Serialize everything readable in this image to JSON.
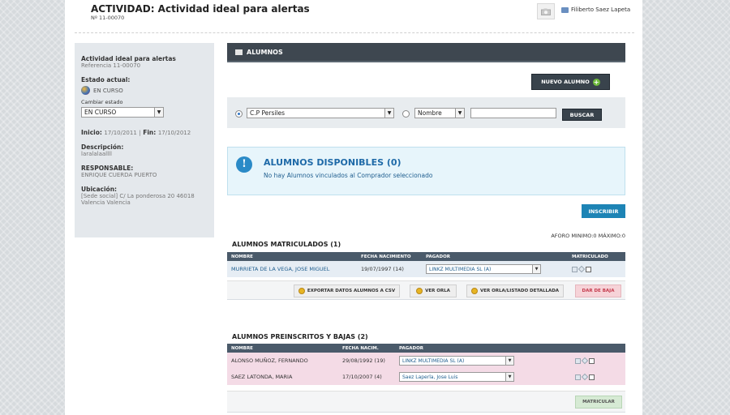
{
  "header": {
    "title": "ACTIVIDAD: Actividad ideal para alertas",
    "code": "Nº 11-00070",
    "user": "Filiberto Saez Lapeta",
    "photo_icon": "camera-icon",
    "user_icon": "id-card-icon"
  },
  "sidebar": {
    "activity_name": "Actividad ideal para alertas",
    "reference": "Referencia 11-00070",
    "estado_label": "Estado actual:",
    "estado_value": "EN CURSO",
    "cambiar_label": "Cambiar estado",
    "cambiar_value": "EN CURSO",
    "inicio_label": "Inicio:",
    "inicio_value": "17/10/2011",
    "separator": "|",
    "fin_label": "Fin:",
    "fin_value": "17/10/2012",
    "descripcion_label": "Descripción:",
    "descripcion_value": "laralalaallll",
    "responsable_label": "RESPONSABLE:",
    "responsable_value": "ENRIQUE CUERDA PUERTO",
    "ubicacion_label": "Ubicación:",
    "ubicacion_line1": "[Sede social] C/ La ponderosa 20 46018",
    "ubicacion_line2": "Valencia Valencia"
  },
  "main": {
    "section_title": "ALUMNOS",
    "nuevo_alumno": "NUEVO ALUMNO",
    "filter": {
      "center_value": "C.P Persiles",
      "field_value": "Nombre",
      "search_value": "",
      "buscar": "BUSCAR"
    },
    "info": {
      "title": "ALUMNOS DISPONIBLES (0)",
      "message": "No hay Alumnos vinculados al Comprador seleccionado"
    },
    "inscribir": "INSCRIBIR",
    "aforo": "AFORO MINIMO:0  MÁXIMO:0",
    "matriculados": {
      "title": "ALUMNOS MATRICULADOS (1)",
      "headers": [
        "NOMBRE",
        "FECHA NACIMIENTO",
        "PAGADOR",
        "MATRICULADO"
      ],
      "rows": [
        {
          "nombre": "MURRIETA DE LA VEGA, JOSE MIGUEL",
          "fecha": "19/07/1997 (14)",
          "pagador": "LINKZ MULTIMEDIA SL (A)"
        }
      ],
      "btn_exportar": "EXPORTAR DATOS ALUMNOS A CSV",
      "btn_ver_orla": "VER ORLA",
      "btn_ver_listado": "VER ORLA/LISTADO DETALLADA",
      "btn_dar_baja": "DAR DE BAJA"
    },
    "preinscritos": {
      "title": "ALUMNOS PREINSCRITOS Y BAJAS (2)",
      "headers": [
        "NOMBRE",
        "FECHA NACIM.",
        "PAGADOR"
      ],
      "rows": [
        {
          "nombre": "ALONSO MUÑOZ, FERNANDO",
          "fecha": "29/08/1992 (19)",
          "pagador": "LINKZ MULTIMEDIA SL (A)"
        },
        {
          "nombre": "SAEZ LATONDA, MARIA",
          "fecha": "17/10/2007 (4)",
          "pagador": "Saez Laperla, Jose Luis"
        }
      ],
      "btn_matricular": "MATRICULAR"
    }
  }
}
